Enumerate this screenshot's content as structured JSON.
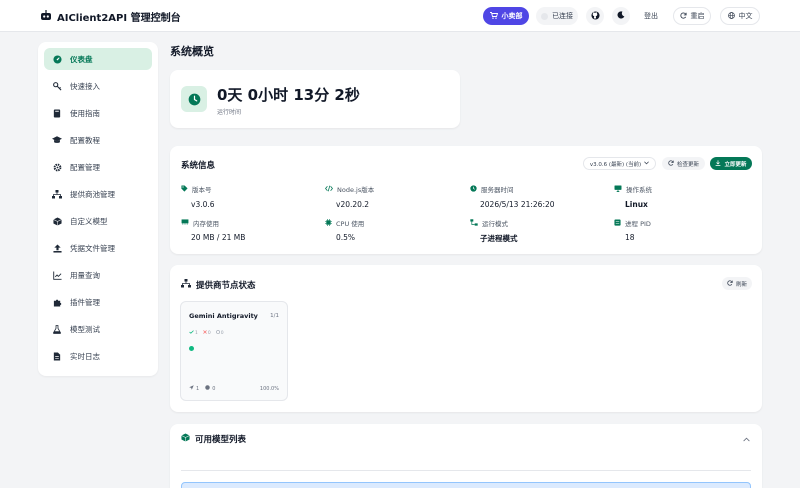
{
  "header": {
    "title": "AIClient2API 管理控制台",
    "shop_label": "小卖部",
    "connection_label": "已连接",
    "logout_label": "登出",
    "restart_label": "重启",
    "language_label": "中文"
  },
  "sidebar": {
    "items": [
      {
        "label": "仪表盘",
        "icon": "dashboard-icon",
        "active": true
      },
      {
        "label": "快速接入",
        "icon": "key-icon"
      },
      {
        "label": "使用指南",
        "icon": "book-icon"
      },
      {
        "label": "配置教程",
        "icon": "graduation-icon"
      },
      {
        "label": "配置管理",
        "icon": "gear-icon"
      },
      {
        "label": "提供商池管理",
        "icon": "network-icon"
      },
      {
        "label": "自定义模型",
        "icon": "cube-icon"
      },
      {
        "label": "凭据文件管理",
        "icon": "upload-icon"
      },
      {
        "label": "用量查询",
        "icon": "chart-icon"
      },
      {
        "label": "插件管理",
        "icon": "puzzle-icon"
      },
      {
        "label": "模型测试",
        "icon": "flask-icon"
      },
      {
        "label": "实时日志",
        "icon": "file-icon"
      }
    ]
  },
  "main": {
    "page_title": "系统概览",
    "uptime": {
      "value": "0天 0小时 13分 2秒",
      "label": "运行时间"
    },
    "system_info": {
      "title": "系统信息",
      "version_select": "v3.0.6 (最新) (当前)",
      "check_update_label": "检查更新",
      "update_now_label": "立即更新",
      "fields": [
        {
          "label": "版本号",
          "value": "v3.0.6",
          "icon": "tag-icon"
        },
        {
          "label": "Node.js版本",
          "value": "v20.20.2",
          "icon": "code-icon"
        },
        {
          "label": "服务器时间",
          "value": "2026/5/13 21:26:20",
          "icon": "clock-icon"
        },
        {
          "label": "操作系统",
          "value": "Linux",
          "icon": "monitor-icon"
        },
        {
          "label": "内存使用",
          "value": "20 MB / 21 MB",
          "icon": "memory-icon"
        },
        {
          "label": "CPU 使用",
          "value": "0.5%",
          "icon": "cpu-icon"
        },
        {
          "label": "运行模式",
          "value": "子进程模式",
          "icon": "sitemap-icon"
        },
        {
          "label": "进程 PID",
          "value": "18",
          "icon": "list-icon"
        }
      ]
    },
    "provider_status": {
      "title": "提供商节点状态",
      "refresh_label": "刷新",
      "providers": [
        {
          "name": "Gemini Antigravity",
          "count": "1/1",
          "healthy": "1",
          "unhealthy": "0",
          "disabled": "0",
          "requests": "1",
          "errors": "0",
          "rate": "100.0%"
        }
      ]
    },
    "models": {
      "title": "可用模型列表"
    }
  },
  "colors": {
    "accent_green": "#047857",
    "primary": "#4f46e5",
    "active_bg": "#d9f0e4"
  }
}
